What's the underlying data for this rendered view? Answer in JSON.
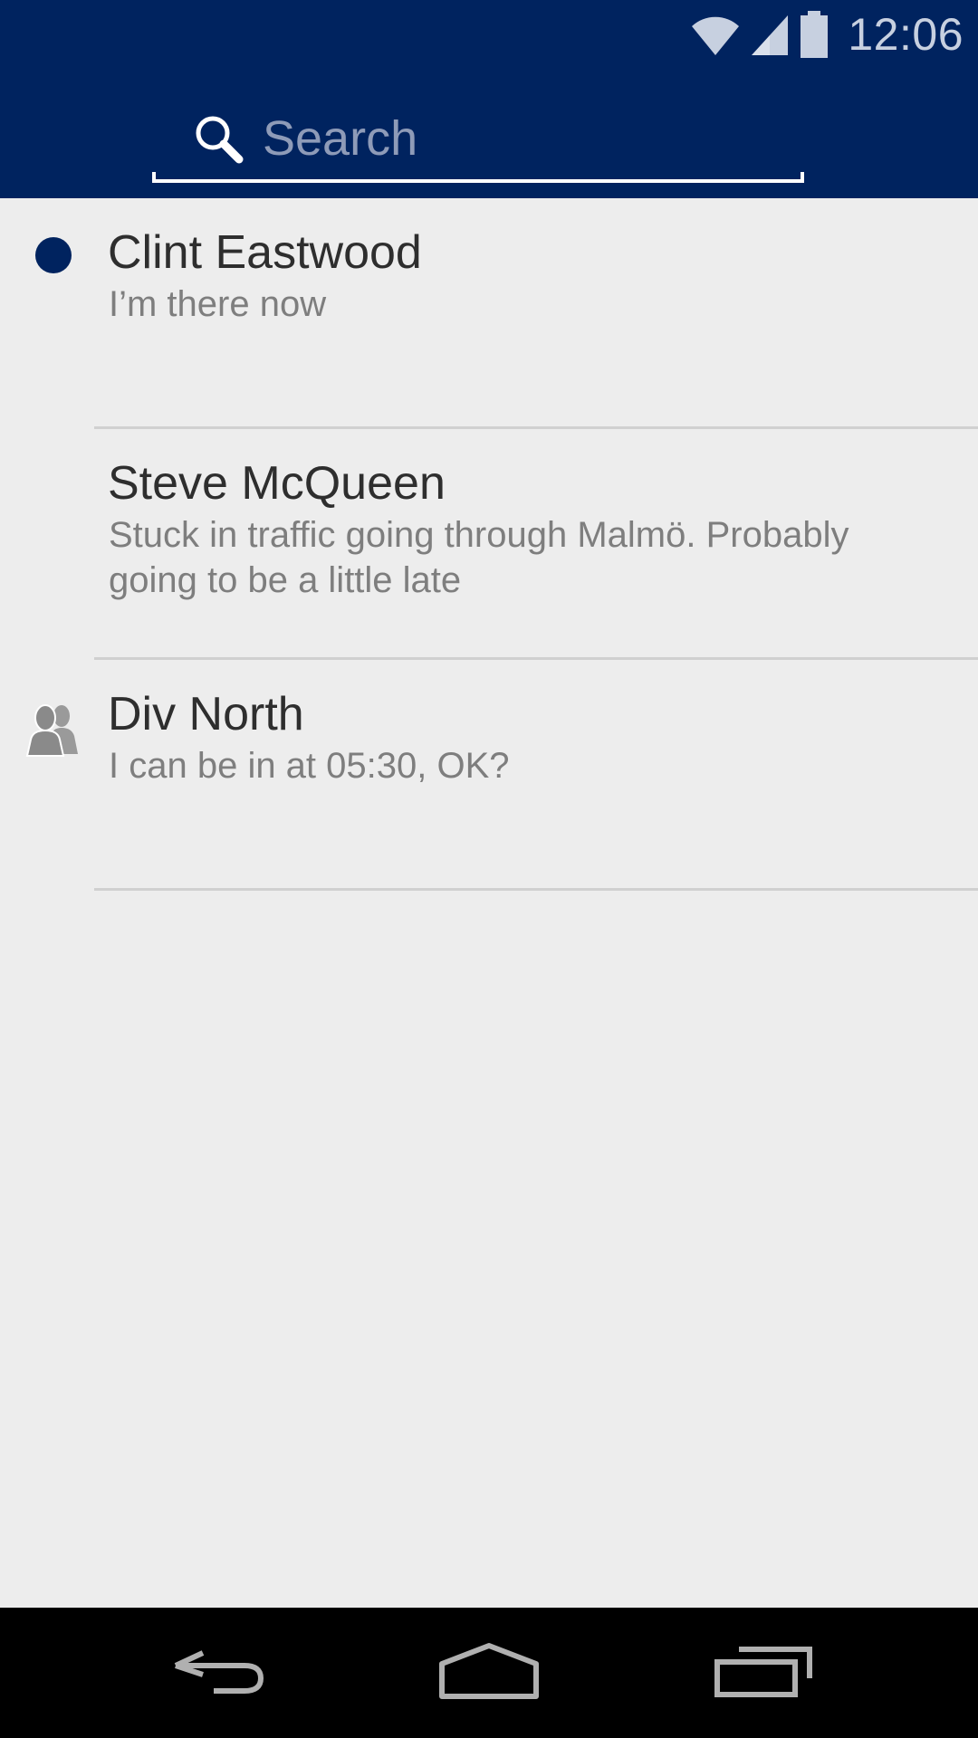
{
  "status_bar": {
    "time": "12:06",
    "icons": [
      "wifi-icon",
      "cell-signal-icon",
      "battery-icon"
    ]
  },
  "search": {
    "placeholder": "Search",
    "value": ""
  },
  "conversations": [
    {
      "name": "Clint Eastwood",
      "message": "I’m there now",
      "indicator": "unread-dot"
    },
    {
      "name": "Steve McQueen",
      "message": "Stuck in traffic going through Malmö. Probably going to be a little late",
      "indicator": "none"
    },
    {
      "name": "Div North",
      "message": "I can be in at 05:30, OK?",
      "indicator": "group-icon"
    }
  ],
  "nav_bar": {
    "buttons": [
      "back-icon",
      "home-icon",
      "recent-apps-icon"
    ]
  },
  "colors": {
    "header": "#00235f",
    "background": "#ededed",
    "unread_dot": "#00235f",
    "title_text": "#2e2e2e",
    "message_text": "#7e7e7e",
    "divider": "#d0d0d0",
    "navbar": "#000000"
  }
}
